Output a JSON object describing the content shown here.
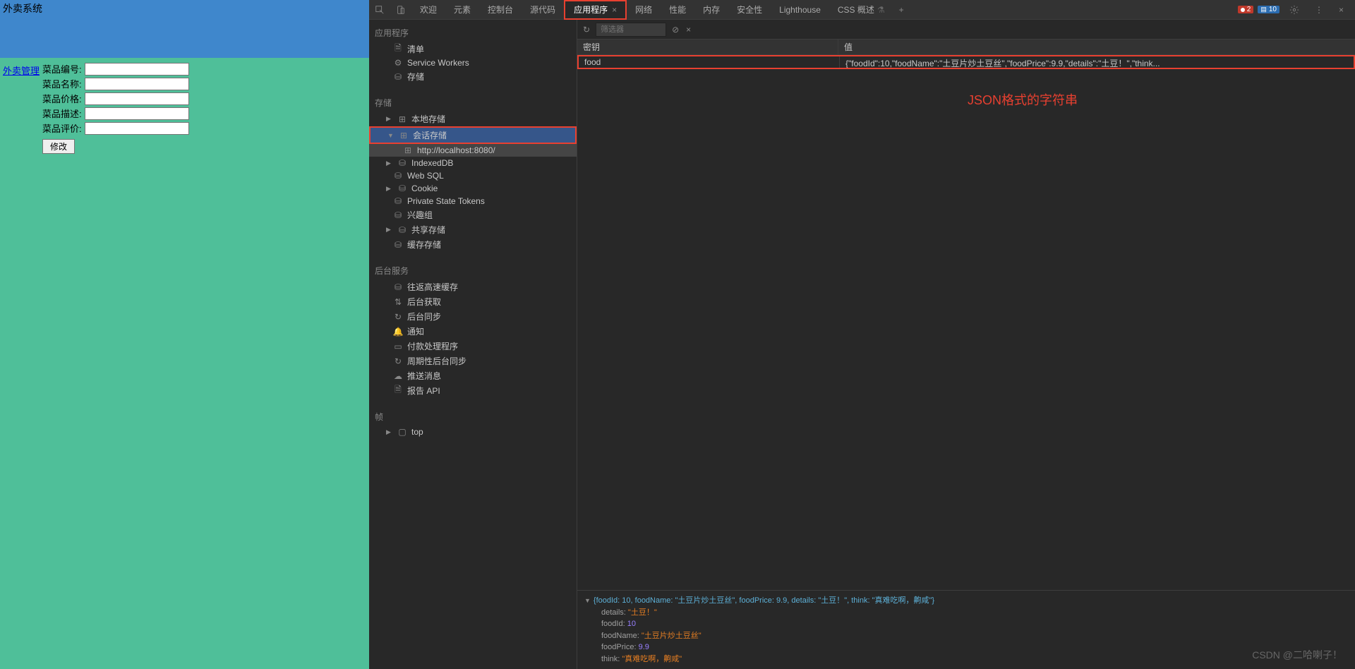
{
  "app": {
    "title": "外卖系统",
    "sidebar_link": "外卖管理",
    "form": {
      "labels": {
        "id": "菜品编号:",
        "name": "菜品名称:",
        "price": "菜品价格:",
        "desc": "菜品描述:",
        "review": "菜品评价:"
      },
      "button": "修改"
    }
  },
  "devtools": {
    "tabs": {
      "welcome": "欢迎",
      "elements": "元素",
      "console": "控制台",
      "sources": "源代码",
      "application": "应用程序",
      "network": "网络",
      "performance": "性能",
      "memory": "内存",
      "security": "安全性",
      "lighthouse": "Lighthouse",
      "css": "CSS 概述"
    },
    "badges": {
      "errors": "2",
      "messages": "10"
    },
    "sidebar": {
      "application_header": "应用程序",
      "manifest": "清单",
      "service_workers": "Service Workers",
      "storage_label": "存储",
      "storage_header": "存储",
      "local_storage": "本地存储",
      "session_storage": "会话存储",
      "session_url": "http://localhost:8080/",
      "indexeddb": "IndexedDB",
      "websql": "Web SQL",
      "cookie": "Cookie",
      "private_tokens": "Private State Tokens",
      "interest": "兴趣组",
      "shared_storage": "共享存储",
      "cache_storage": "缓存存储",
      "bg_header": "后台服务",
      "back_forward": "往返高速缓存",
      "bg_fetch": "后台获取",
      "bg_sync": "后台同步",
      "notifications": "通知",
      "payment": "付款处理程序",
      "periodic_sync": "周期性后台同步",
      "push": "推送消息",
      "report_api": "报告 API",
      "frame_header": "帧",
      "frame_top": "top"
    },
    "filter": {
      "placeholder": "筛选器"
    },
    "table": {
      "key_header": "密钥",
      "value_header": "值",
      "row_key": "food",
      "row_value": "{\"foodId\":10,\"foodName\":\"土豆片炒土豆丝\",\"foodPrice\":9.9,\"details\":\"土豆！\",\"think..."
    },
    "annotation": "JSON格式的字符串",
    "preview": {
      "summary": "{foodId: 10, foodName: \"土豆片炒土豆丝\", foodPrice: 9.9, details: \"土豆！\", think: \"真难吃啊，齁咸\"}",
      "details_key": "details:",
      "details_val": "\"土豆！\"",
      "foodId_key": "foodId:",
      "foodId_val": "10",
      "foodName_key": "foodName:",
      "foodName_val": "\"土豆片炒土豆丝\"",
      "foodPrice_key": "foodPrice:",
      "foodPrice_val": "9.9",
      "think_key": "think:",
      "think_val": "\"真难吃啊，齁咸\""
    }
  },
  "watermark": "CSDN @二哈喇子！"
}
